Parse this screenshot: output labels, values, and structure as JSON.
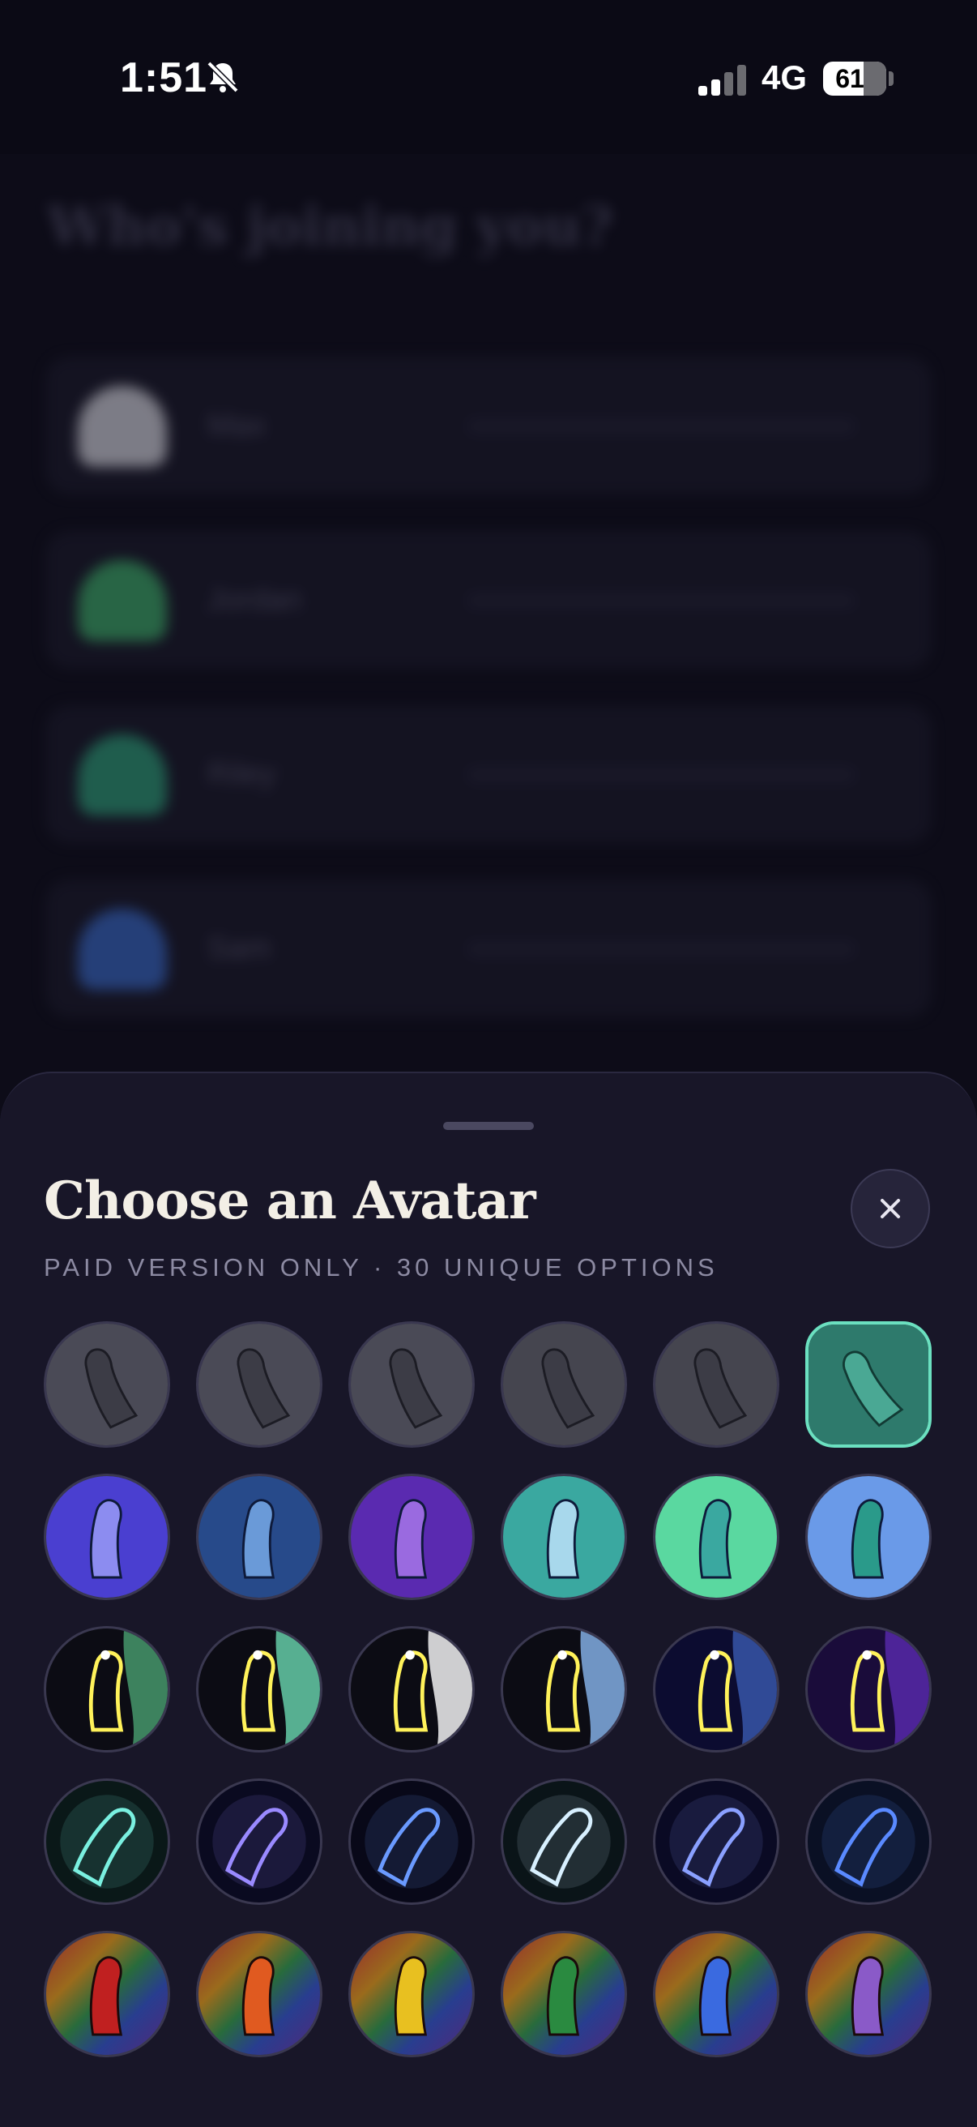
{
  "status_bar": {
    "time": "1:51",
    "network": "4G",
    "battery": "61",
    "icons": [
      "bell-slash-icon",
      "signal-icon",
      "battery-icon"
    ]
  },
  "background_screen": {
    "title": "Who's joining you?",
    "subtitle": "",
    "cards": [
      {
        "name": "Max",
        "color": "#d8d8e0"
      },
      {
        "name": "Jordan",
        "color": "#3fae6a"
      },
      {
        "name": "Riley",
        "color": "#2fa07a"
      },
      {
        "name": "Sam",
        "color": "#3a6ac8"
      }
    ]
  },
  "sheet": {
    "title": "Choose an Avatar",
    "subtitle": "PAID VERSION ONLY · 30 UNIQUE OPTIONS",
    "close_icon": "close-icon",
    "selected_index": 5,
    "avatars": [
      {
        "style": "gray",
        "bg": "#4a4a56"
      },
      {
        "style": "gray",
        "bg": "#4a4a56"
      },
      {
        "style": "gray",
        "bg": "#4a4a56"
      },
      {
        "style": "gray",
        "bg": "#45454f"
      },
      {
        "style": "gray",
        "bg": "#45454f"
      },
      {
        "style": "teal",
        "bg": "#2e7a6c"
      },
      {
        "style": "solid",
        "bg": "#4a3fd0",
        "fg": "#8c8cf0"
      },
      {
        "style": "solid",
        "bg": "#274a8a",
        "fg": "#6a9ad8"
      },
      {
        "style": "solid",
        "bg": "#5a2ab0",
        "fg": "#9a6ae0"
      },
      {
        "style": "solid",
        "bg": "#3aa8a0",
        "fg": "#a8d8ec"
      },
      {
        "style": "solid",
        "bg": "#5ad8a0",
        "fg": "#3aa8a0"
      },
      {
        "style": "solid",
        "bg": "#6a9ae8",
        "fg": "#2a9a8a"
      },
      {
        "style": "neon",
        "bg": "#0c0c14",
        "accent": "#4aa070",
        "glow": "#fff25a"
      },
      {
        "style": "neon",
        "bg": "#0c0c14",
        "accent": "#6ad8b0",
        "glow": "#fff25a"
      },
      {
        "style": "neon",
        "bg": "#0c0c14",
        "accent": "#ffffff",
        "glow": "#fff25a"
      },
      {
        "style": "neon",
        "bg": "#0c0c14",
        "accent": "#8ab8f0",
        "glow": "#fff25a"
      },
      {
        "style": "neon",
        "bg": "#0c0c30",
        "accent": "#3a5ab0",
        "glow": "#fff25a"
      },
      {
        "style": "neon",
        "bg": "#1a0c3a",
        "accent": "#5a2ab0",
        "glow": "#fff25a"
      },
      {
        "style": "glow",
        "bg": "#0a1818",
        "glow": "#7af0e0"
      },
      {
        "style": "glow",
        "bg": "#0a0a20",
        "glow": "#9a8aff"
      },
      {
        "style": "glow",
        "bg": "#080818",
        "glow": "#6a9aff"
      },
      {
        "style": "glow",
        "bg": "#0a1418",
        "glow": "#d8f0ff"
      },
      {
        "style": "glow",
        "bg": "#0a0a24",
        "glow": "#8aa0ff"
      },
      {
        "style": "glow",
        "bg": "#0a1024",
        "glow": "#5a8aff"
      },
      {
        "style": "rainbow",
        "fg": "#c02020"
      },
      {
        "style": "rainbow",
        "fg": "#e05a20"
      },
      {
        "style": "rainbow",
        "fg": "#e8c020"
      },
      {
        "style": "rainbow",
        "fg": "#2a8a40"
      },
      {
        "style": "rainbow",
        "fg": "#3a6ae0"
      },
      {
        "style": "rainbow",
        "fg": "#8a5ac8"
      }
    ]
  }
}
